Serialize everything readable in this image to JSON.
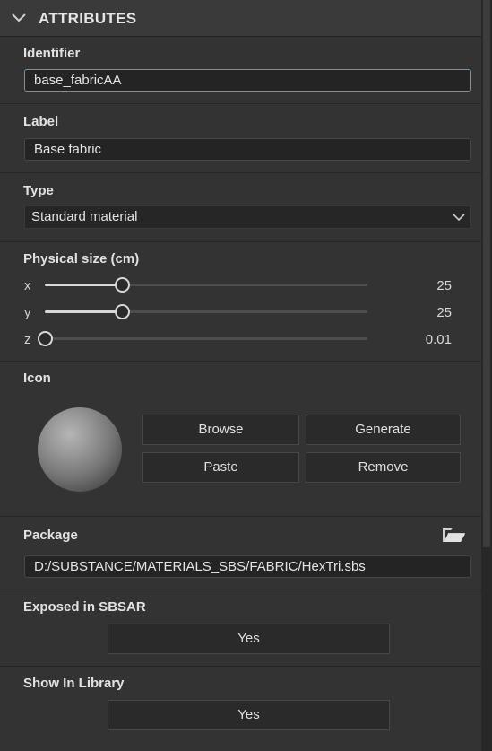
{
  "header": {
    "title": "ATTRIBUTES",
    "collapse_icon": "chevron-down-icon"
  },
  "identifier": {
    "label": "Identifier",
    "value": "base_fabricAA"
  },
  "label_field": {
    "label": "Label",
    "value": "Base fabric"
  },
  "type": {
    "label": "Type",
    "value": "Standard material",
    "icon": "chevron-down-icon"
  },
  "physical_size": {
    "label": "Physical size (cm)",
    "axes": [
      {
        "axis": "x",
        "value": "25",
        "level": 0.24
      },
      {
        "axis": "y",
        "value": "25",
        "level": 0.24
      },
      {
        "axis": "z",
        "value": "0.01",
        "level": 0.0
      }
    ]
  },
  "icon_section": {
    "label": "Icon",
    "preview": "sphere-preview",
    "buttons": {
      "browse": "Browse",
      "generate": "Generate",
      "paste": "Paste",
      "remove": "Remove"
    }
  },
  "package": {
    "label": "Package",
    "value": "D:/SUBSTANCE/MATERIALS_SBS/FABRIC/HexTri.sbs",
    "icon": "folder-open-icon"
  },
  "exposed": {
    "label": "Exposed in SBSAR",
    "value": "Yes"
  },
  "show_in_library": {
    "label": "Show In Library",
    "value": "Yes"
  },
  "colors": {
    "panel": "#333333",
    "header": "#3a3a3a",
    "focus": "#4a9fd8",
    "field": "#242424"
  }
}
